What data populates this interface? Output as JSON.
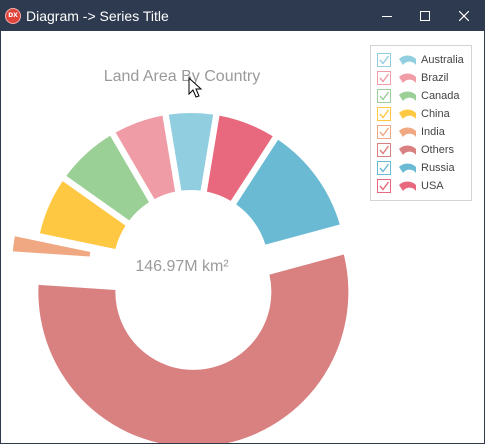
{
  "window": {
    "title": "Diagram -> Series Title",
    "app_icon_text": "DX",
    "icon_color": "#e0443b",
    "titlebar_color": "#2d3a4f"
  },
  "chart_data": {
    "type": "pie",
    "variant": "exploded-donut",
    "title": "Land Area By Country",
    "total_label": "146.97M km²",
    "legend_position": "top-right",
    "slices": [
      {
        "name": "Russia",
        "value": 17.1,
        "color": "#6bbad4",
        "exploded": false
      },
      {
        "name": "Others",
        "value": 81.2,
        "color": "#d98080",
        "exploded": true
      },
      {
        "name": "India",
        "value": 3.28,
        "color": "#f0a882",
        "exploded": true
      },
      {
        "name": "China",
        "value": 9.6,
        "color": "#ffc843",
        "exploded": false
      },
      {
        "name": "Canada",
        "value": 9.98,
        "color": "#9acf96",
        "exploded": false
      },
      {
        "name": "Brazil",
        "value": 8.51,
        "color": "#f09ca6",
        "exploded": false
      },
      {
        "name": "Australia",
        "value": 7.69,
        "color": "#91cfe0",
        "exploded": false
      },
      {
        "name": "USA",
        "value": 9.63,
        "color": "#e8697d",
        "exploded": false
      }
    ],
    "start_angle_deg": 33
  },
  "legend": {
    "items": [
      {
        "label": "Australia",
        "color": "#91cfe0",
        "checked": true
      },
      {
        "label": "Brazil",
        "color": "#f09ca6",
        "checked": true
      },
      {
        "label": "Canada",
        "color": "#9acf96",
        "checked": true
      },
      {
        "label": "China",
        "color": "#ffc843",
        "checked": true
      },
      {
        "label": "India",
        "color": "#f0a882",
        "checked": true
      },
      {
        "label": "Others",
        "color": "#d98080",
        "checked": true
      },
      {
        "label": "Russia",
        "color": "#6bbad4",
        "checked": true
      },
      {
        "label": "USA",
        "color": "#e8697d",
        "checked": true
      }
    ]
  }
}
